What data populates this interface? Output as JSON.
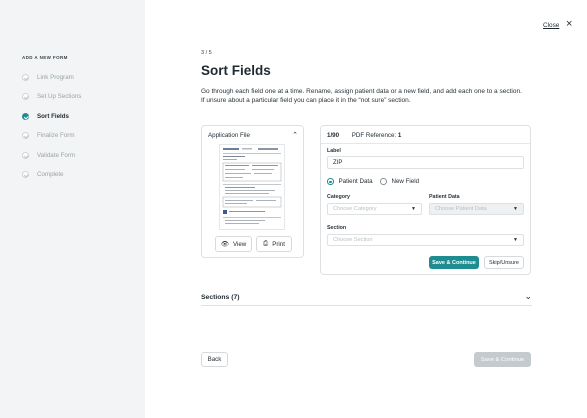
{
  "sidebar": {
    "title": "ADD A NEW FORM",
    "steps": [
      {
        "label": "Link Program"
      },
      {
        "label": "Set Up Sections"
      },
      {
        "label": "Sort Fields"
      },
      {
        "label": "Finalize Form"
      },
      {
        "label": "Validate Form"
      },
      {
        "label": "Complete"
      }
    ],
    "active_step": 2
  },
  "header": {
    "close_label": "Close",
    "close_icon": "×"
  },
  "main": {
    "counter": "3 / 5",
    "title": "Sort Fields",
    "instructions": "Go through each field one at a time. Rename, assign patient data or a new field, and add each one to a section. If unsure about a particular field you can place it in the “not sure” section."
  },
  "application_file": {
    "title": "Application File",
    "view_label": "View",
    "print_label": "Print"
  },
  "field_card": {
    "counter": "1/90",
    "pdf_reference_label": "PDF Reference:",
    "pdf_reference_value": "1",
    "label_label": "Label",
    "label_value": "ZIP",
    "radio_patient": "Patient Data",
    "radio_new": "New Field",
    "category_label": "Category",
    "category_placeholder": "Choose Category",
    "patient_data_label": "Patient Data",
    "patient_data_placeholder": "Choose Patient Data",
    "section_label": "Section",
    "section_placeholder": "Choose Section",
    "save_continue_label": "Save & Continue",
    "skip_label": "Skip/Unsure"
  },
  "sections": {
    "label": "Sections (7)"
  },
  "footer": {
    "back_label": "Back",
    "save_continue_label": "Save & Continue"
  },
  "colors": {
    "accent": "#1e8c91",
    "sidebar_bg": "#f3f4f5",
    "disabled_button": "#c4cacd"
  }
}
